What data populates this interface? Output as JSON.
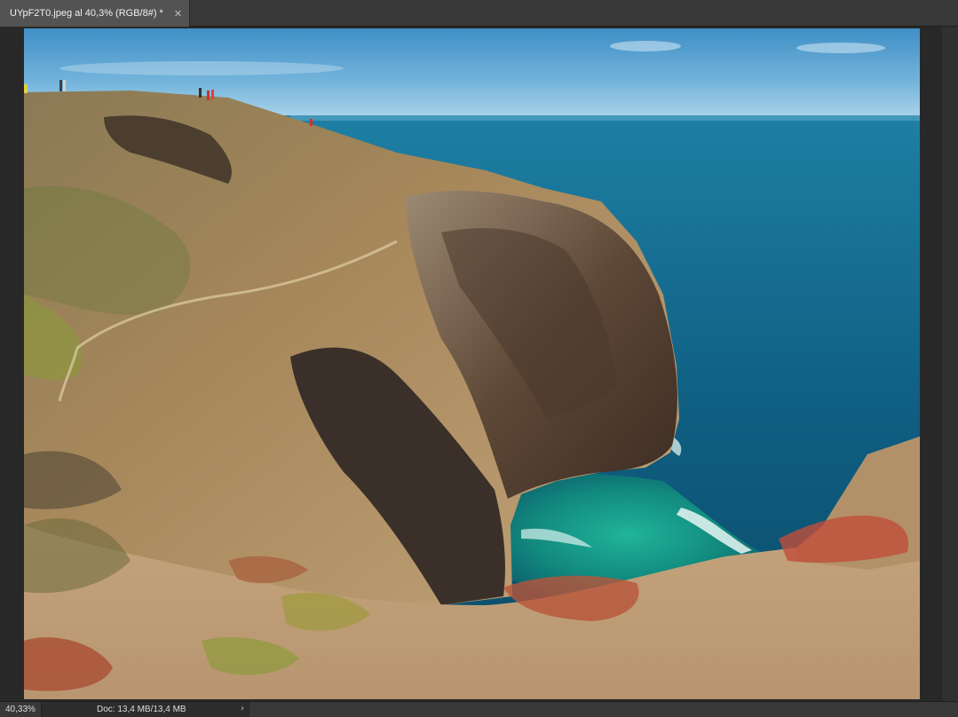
{
  "document_tab": {
    "title": "UYpF2T0.jpeg al 40,3% (RGB/8#) *",
    "close_icon": "close-icon"
  },
  "statusbar": {
    "zoom": "40,33%",
    "doc_size": "Doc: 13,4 MB/13,4 MB",
    "menu_arrow": "›"
  },
  "colors": {
    "ui_background": "#282828",
    "tab_active": "#535353",
    "sky": "#4a9ccc",
    "sea": "#0f5a7a",
    "surf": "#2bb59b",
    "cliff": "#6b5440"
  }
}
